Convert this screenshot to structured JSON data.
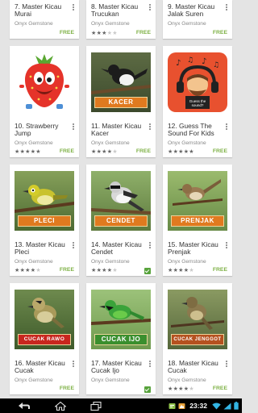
{
  "colors": {
    "free": "#7fb247",
    "background": "#e4e4e4",
    "installed": "#58a33c"
  },
  "apps": [
    {
      "title": "7. Master Kicau Murai",
      "developer": "Onyx Gemstone",
      "rating": 0,
      "price": "FREE"
    },
    {
      "title": "8. Master Kicau Trucukan",
      "developer": "Onyx Gemstone",
      "rating": 3,
      "price": "FREE"
    },
    {
      "title": "9. Master Kicau Jalak Suren",
      "developer": "Onyx Gemstone",
      "rating": 0,
      "price": "FREE"
    },
    {
      "title": "10. Strawberry Jump",
      "developer": "Onyx Gemstone",
      "rating": 5,
      "price": "FREE"
    },
    {
      "title": "11. Master Kicau Kacer",
      "developer": "Onyx Gemstone",
      "rating": 4,
      "price": "FREE",
      "image_text": "KACER"
    },
    {
      "title": "12. Guess The Sound For Kids",
      "developer": "Onyx Gemstone",
      "rating": 5,
      "price": "FREE",
      "image_text": "Guess the sound?"
    },
    {
      "title": "13. Master Kicau Pleci",
      "developer": "Onyx Gemstone",
      "rating": 4,
      "price": "FREE",
      "image_text": "PLECI"
    },
    {
      "title": "14. Master Kicau Cendet",
      "developer": "Onyx Gemstone",
      "rating": 4,
      "price": "",
      "installed": true,
      "image_text": "CENDET"
    },
    {
      "title": "15. Master Kicau Prenjak",
      "developer": "Onyx Gemstone",
      "rating": 4,
      "price": "FREE",
      "image_text": "PRENJAK"
    },
    {
      "title": "16. Master Kicau Cucak",
      "developer": "Onyx Gemstone",
      "rating": 0,
      "price": "FREE",
      "image_text": "CUCAK RAWO"
    },
    {
      "title": "17. Master Kicau Cucak Ijo",
      "developer": "Onyx Gemstone",
      "rating": 0,
      "price": "",
      "installed": true,
      "image_text": "CUCAK IJO"
    },
    {
      "title": "18. Master Kicau Cucak",
      "developer": "Onyx Gemstone",
      "rating": 4,
      "price": "FREE",
      "image_text": "CUCAK JENGGOT"
    }
  ],
  "status_bar": {
    "time": "23:32"
  },
  "icons": {
    "nav": [
      "back-icon",
      "home-icon",
      "recent-apps-icon"
    ],
    "status": [
      "notification-icon",
      "notification-icon",
      "clock-time",
      "wifi-icon",
      "signal-icon",
      "battery-icon"
    ]
  }
}
